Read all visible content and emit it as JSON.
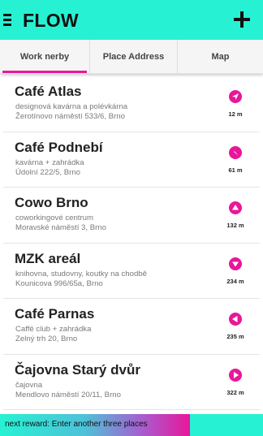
{
  "colors": {
    "accent": "#26f2d3",
    "pink": "#e8179a"
  },
  "header": {
    "title": "FLOW",
    "menu_icon": "hamburger-menu-icon",
    "add_icon": "plus-icon"
  },
  "tabs": [
    {
      "label": "Work nerby",
      "active": true
    },
    {
      "label": "Place Address",
      "active": false
    },
    {
      "label": "Map",
      "active": false
    }
  ],
  "places": [
    {
      "name": "Café Atlas",
      "description": "designová kavárna a polévkárna",
      "address": "Žerotínovo náměstí 533/6, Brno",
      "distance": "12 m",
      "direction_icon": "navigation-arrow-icon"
    },
    {
      "name": "Café Podnebí",
      "description": "kavárna + zahrádka",
      "address": "Údolní 222/5, Brno",
      "distance": "61 m",
      "direction_icon": "navigation-arrow-icon"
    },
    {
      "name": "Cowo Brno",
      "description": "coworkingové centrum",
      "address": "Moravské náměstí 3, Brno",
      "distance": "132 m",
      "direction_icon": "navigation-arrow-icon"
    },
    {
      "name": "MZK areál",
      "description": "knihovna, studovny, koutky na chodbě",
      "address": "Kounicova 996/65a, Brno",
      "distance": "234 m",
      "direction_icon": "navigation-arrow-icon"
    },
    {
      "name": "Café Parnas",
      "description": "Caffé club + zahrádka",
      "address": "Zelný trh 20, Brno",
      "distance": "235 m",
      "direction_icon": "navigation-arrow-icon"
    },
    {
      "name": "Čajovna Starý dvůr",
      "description": "čajovna",
      "address": "Mendlovo náměstí 20/11, Brno",
      "distance": "322 m",
      "direction_icon": "navigation-arrow-icon"
    }
  ],
  "footer": {
    "reward_text": "next reward: Enter another three places"
  }
}
